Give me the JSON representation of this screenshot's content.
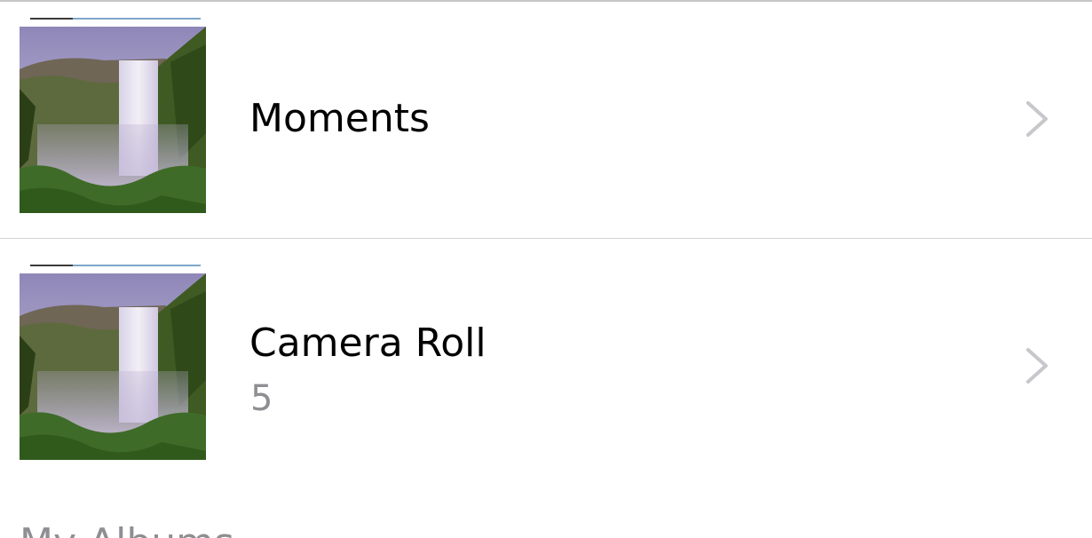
{
  "albums": [
    {
      "title": "Moments",
      "count": "",
      "thumbnail_icon": "waterfall-photo-thumbnail"
    },
    {
      "title": "Camera Roll",
      "count": "5",
      "thumbnail_icon": "waterfall-photo-thumbnail"
    }
  ],
  "section_header": "My Albums",
  "colors": {
    "title": "#000000",
    "count": "#8e8e93",
    "chevron": "#c7c7cc",
    "divider": "#d4d4d6"
  }
}
